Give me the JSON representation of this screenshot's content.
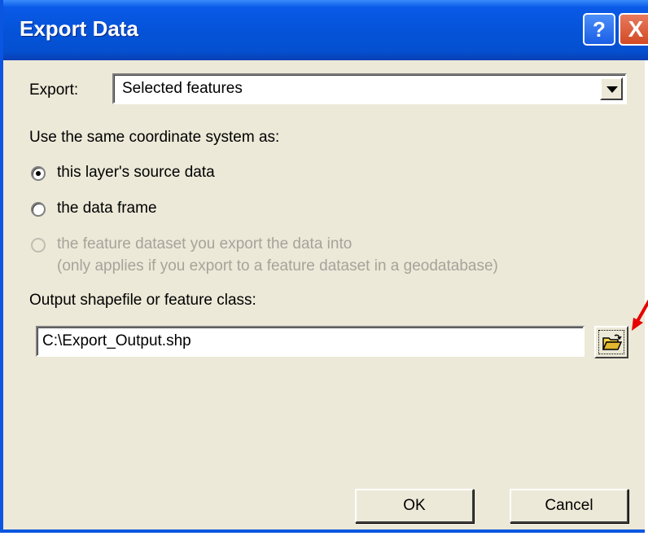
{
  "window": {
    "title": "Export Data",
    "help_label": "?",
    "close_label": "X"
  },
  "export": {
    "label": "Export:",
    "selected": "Selected features"
  },
  "coordinate": {
    "heading": "Use the same coordinate system as:",
    "options": [
      {
        "label": "this layer's source data",
        "checked": true,
        "enabled": true
      },
      {
        "label": "the data frame",
        "checked": false,
        "enabled": true
      },
      {
        "label": "the feature dataset you export the data into",
        "sublabel": "(only applies if you export to a feature dataset in a geodatabase)",
        "checked": false,
        "enabled": false
      }
    ]
  },
  "output": {
    "label": "Output shapefile or feature class:",
    "value": "C:\\Export_Output.shp",
    "browse_icon": "open-folder-icon"
  },
  "buttons": {
    "ok": "OK",
    "cancel": "Cancel"
  },
  "colors": {
    "title_bar": "#0553d9",
    "dialog_bg": "#ece9d8",
    "disabled_text": "#a6a39a",
    "annotation_arrow": "#e60000"
  }
}
